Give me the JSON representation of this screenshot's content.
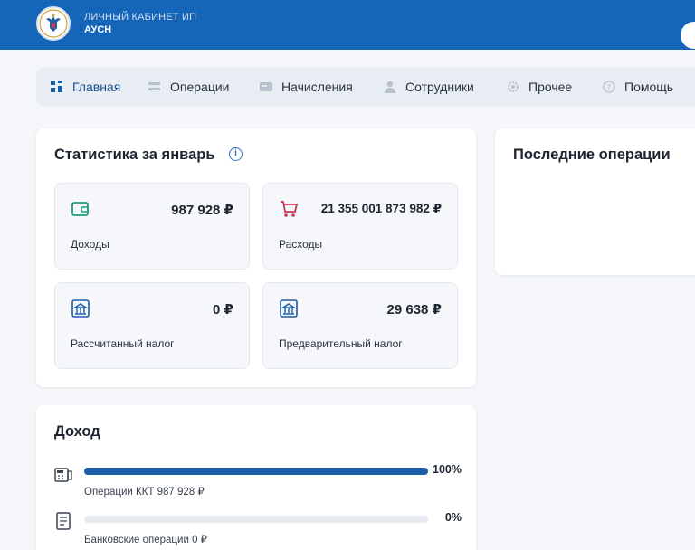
{
  "header": {
    "title": "ЛИЧНЫЙ КАБИНЕТ ИП",
    "subtitle": "АУСН",
    "brand_color": "#1565b8"
  },
  "nav": {
    "items": [
      {
        "label": "Главная",
        "icon": "grid-icon",
        "active": true
      },
      {
        "label": "Операции",
        "icon": "list-icon"
      },
      {
        "label": "Начисления",
        "icon": "card-icon"
      },
      {
        "label": "Сотрудники",
        "icon": "person-icon"
      },
      {
        "label": "Прочее",
        "icon": "gear-icon"
      },
      {
        "label": "Помощь",
        "icon": "help-icon"
      }
    ]
  },
  "stats": {
    "title": "Статистика за январь",
    "tiles": [
      {
        "value": "987 928 ₽",
        "label": "Доходы",
        "icon": "wallet-icon",
        "color": "#1f9e7a"
      },
      {
        "value": "21 355 001 873 982 ₽",
        "label": "Расходы",
        "icon": "cart-icon",
        "color": "#c43d4e"
      },
      {
        "value": "0 ₽",
        "label": "Рассчитанный налог",
        "icon": "tax-building-icon",
        "color": "#1a5ea8"
      },
      {
        "value": "29 638 ₽",
        "label": "Предварительный налог",
        "icon": "tax-building-icon",
        "color": "#1a5ea8"
      }
    ]
  },
  "recent": {
    "title": "Последние операции"
  },
  "income": {
    "title": "Доход",
    "rows": [
      {
        "label": "Операции ККТ 987 928 ₽",
        "percent_text": "100%",
        "fraction": 1.0,
        "icon": "cash-register-icon"
      },
      {
        "label": "Банковские операции 0 ₽",
        "percent_text": "0%",
        "fraction": 0.0,
        "icon": "bank-document-icon"
      }
    ]
  }
}
